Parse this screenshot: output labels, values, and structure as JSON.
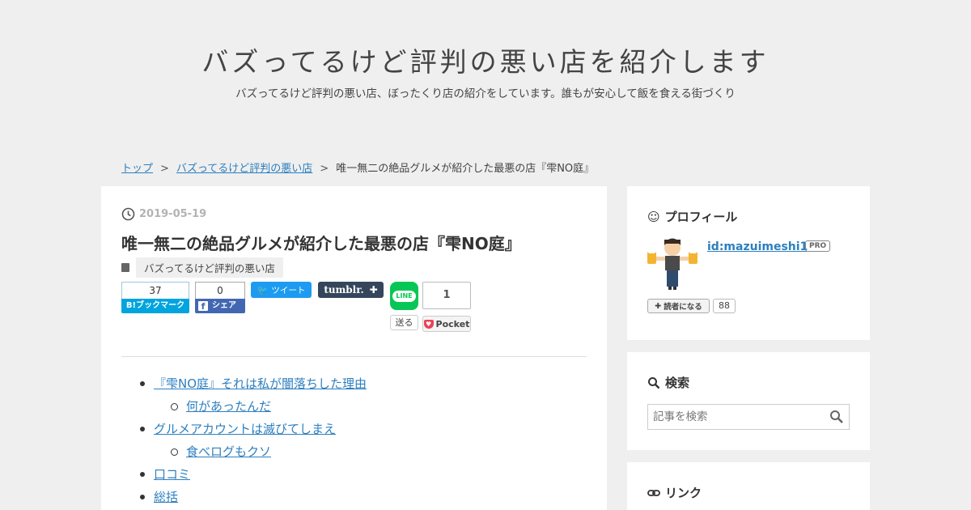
{
  "header": {
    "title": "バズってるけど評判の悪い店を紹介します",
    "description": "バズってるけど評判の悪い店、ぼったくり店の紹介をしています。誰もが安心して飯を食える街づくり"
  },
  "breadcrumb": {
    "home": "トップ",
    "category": "バズってるけど評判の悪い店",
    "current": "唯一無二の絶品グルメが紹介した最悪の店『雫NO庭』",
    "separator": ">"
  },
  "article": {
    "date": "2019-05-19",
    "title": "唯一無二の絶品グルメが紹介した最悪の店『雫NO庭』",
    "category": "バズってるけど評判の悪い店"
  },
  "share": {
    "hatena_count": "37",
    "hatena_label": "B!ブックマーク",
    "facebook_count": "0",
    "facebook_label": "シェア",
    "twitter_label": "ツイート",
    "tumblr_label": "tumblr.",
    "line_label": "LINE",
    "line_send": "送る",
    "pocket_count": "1",
    "pocket_label": "Pocket"
  },
  "toc": [
    {
      "level": 1,
      "text": "『雫NO庭』それは私が闇落ちした理由"
    },
    {
      "level": 2,
      "text": "何があったんだ"
    },
    {
      "level": 1,
      "text": "グルメアカウントは滅びてしまえ"
    },
    {
      "level": 2,
      "text": "食べログもクソ"
    },
    {
      "level": 1,
      "text": "口コミ"
    },
    {
      "level": 1,
      "text": "総括"
    }
  ],
  "sidebar": {
    "profile": {
      "heading": "プロフィール",
      "user_id": "id:mazuimeshi1",
      "badge": "PRO",
      "reader_button": "読者になる",
      "reader_count": "88"
    },
    "search": {
      "heading": "検索",
      "placeholder": "記事を検索"
    },
    "links": {
      "heading": "リンク"
    }
  },
  "colors": {
    "background": "#efefef",
    "link": "#2d7fbf",
    "hatena": "#00a4de",
    "facebook": "#4267b2",
    "twitter": "#1d9bf0",
    "tumblr": "#35465c",
    "line": "#06c755",
    "pocket": "#ee4056"
  },
  "icons": [
    "clock-icon",
    "folder-icon",
    "smile-icon",
    "search-icon",
    "link-icon",
    "plus-icon",
    "twitter-bird-icon",
    "facebook-icon",
    "pocket-icon",
    "line-icon"
  ]
}
